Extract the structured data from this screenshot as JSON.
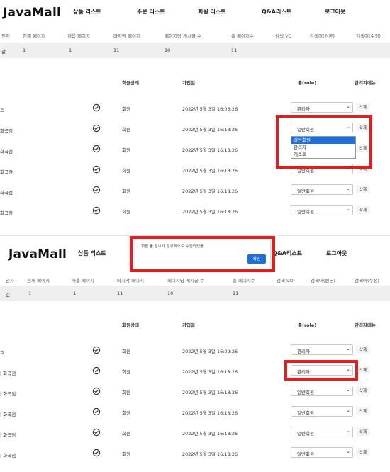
{
  "nav": {
    "logo": "JavaMall",
    "links": [
      "상품 리스트",
      "주문 리스트",
      "회원 리스트",
      "Q&A리스트",
      "로그아웃"
    ]
  },
  "pagination": {
    "headers_top": [
      "인자",
      "현재 페이지",
      "처음 페이지",
      "마지막 페이지",
      "페이지당 게시글 수",
      "총 페이지수",
      "검색 VO",
      "검색어(원본)",
      "검색어(수정)"
    ],
    "headers_bottom": [
      "인자",
      "현재 페이지",
      "처음 페이지",
      "마지막 페이지",
      "페이지당 게시글 수",
      "총 페이지수",
      "검색 VO",
      "검색어(원본)",
      "검색어(수정)"
    ],
    "values_top": [
      "값",
      "1",
      "1",
      "11",
      "10",
      "11"
    ],
    "values_bottom": [
      "값",
      "1",
      "1",
      "11",
      "10",
      "11"
    ]
  },
  "columns": {
    "status": "회원상태",
    "joined": "가입일",
    "role": "룰(role)",
    "admin": "관리자메뉴"
  },
  "members_top": [
    {
      "name": "트",
      "grade": "회원",
      "date": "2022년 5월 3일 16:06:26",
      "role": "관리자",
      "delete": "삭제"
    },
    {
      "name": "화곡점",
      "grade": "회원",
      "date": "2022년 5월 3일 16:18:26",
      "role": "일반회원",
      "delete": "삭제"
    },
    {
      "name": "화곡점",
      "grade": "회원",
      "date": "2022년 5월 3일 16:18:26",
      "role": "일반회원",
      "delete": "삭제"
    },
    {
      "name": "화곡점",
      "grade": "회원",
      "date": "2022년 5월 3일 16:18:26",
      "role": "일반회원",
      "delete": "삭제"
    },
    {
      "name": "화곡점",
      "grade": "회원",
      "date": "2022년 5월 3일 16:18:26",
      "role": "일반회원",
      "delete": "삭제"
    },
    {
      "name": "화곡점",
      "grade": "회원",
      "date": "2022년 5월 3일 16:18:26",
      "role": "일반회원",
      "delete": "삭제"
    }
  ],
  "dropdown_options": [
    "일반회원",
    "관리자",
    "게스트"
  ],
  "alert": {
    "message": "회원 룰 정보가 정상적으로 수정되었음",
    "ok": "확인"
  },
  "members_bottom": [
    {
      "name": "호",
      "grade": "회원",
      "date": "2022년 5월 3일 16:09:26",
      "role": "관리자",
      "delete": "삭제"
    },
    {
      "name": "| 화곡점",
      "grade": "회원",
      "date": "2022년 5월 3일 16:18:26",
      "role": "관리자",
      "delete": "삭제"
    },
    {
      "name": "| 화곡점",
      "grade": "회원",
      "date": "2022년 5월 3일 16:18:26",
      "role": "일반회원",
      "delete": "삭제"
    },
    {
      "name": "| 화곡점",
      "grade": "회원",
      "date": "2022년 5월 3일 16:18:26",
      "role": "일반회원",
      "delete": "삭제"
    },
    {
      "name": "| 화곡점",
      "grade": "회원",
      "date": "2022년 5월 3일 16:18:26",
      "role": "일반회원",
      "delete": "삭제"
    },
    {
      "name": "| 화곡점",
      "grade": "회원",
      "date": "2022년 5월 3일 16:18:26",
      "role": "일반회원",
      "delete": "삭제"
    }
  ],
  "icons": {
    "status": "check-circle-icon",
    "chevron": "chevron-down-icon"
  },
  "colors": {
    "highlight": "#e11d1d",
    "accent": "#1e6fd9",
    "row_bg": "#efefef"
  }
}
